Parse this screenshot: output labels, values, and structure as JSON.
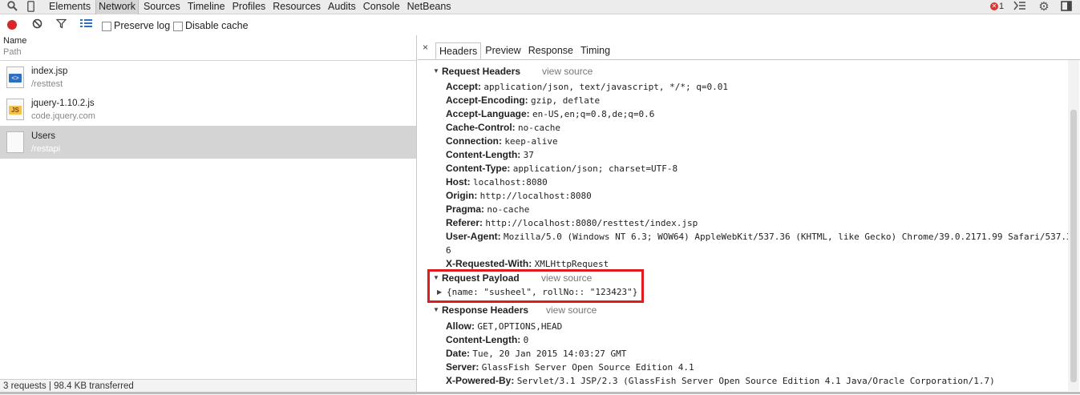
{
  "toolbar": {
    "tabs": [
      "Elements",
      "Network",
      "Sources",
      "Timeline",
      "Profiles",
      "Resources",
      "Audits",
      "Console",
      "NetBeans"
    ],
    "active_tab": "Network",
    "error_count": "1"
  },
  "filterbar": {
    "preserve_log": "Preserve log",
    "disable_cache": "Disable cache"
  },
  "requests": {
    "col_name": "Name",
    "col_path": "Path",
    "rows": [
      {
        "name": "index.jsp",
        "domain": "/resttest",
        "icon": "html-file-icon"
      },
      {
        "name": "jquery-1.10.2.js",
        "domain": "code.jquery.com",
        "icon": "js-file-icon"
      },
      {
        "name": "Users",
        "domain": "/restapi",
        "icon": "blank-file-icon"
      }
    ],
    "summary": "3 requests | 98.4 KB transferred"
  },
  "detail": {
    "close": "×",
    "tabs": [
      "Headers",
      "Preview",
      "Response",
      "Timing"
    ],
    "active_tab": "Headers",
    "view_source": "view source",
    "request_headers_title": "Request Headers",
    "request_headers": [
      {
        "k": "Accept:",
        "v": "application/json, text/javascript, */*; q=0.01"
      },
      {
        "k": "Accept-Encoding:",
        "v": "gzip, deflate"
      },
      {
        "k": "Accept-Language:",
        "v": "en-US,en;q=0.8,de;q=0.6"
      },
      {
        "k": "Cache-Control:",
        "v": "no-cache"
      },
      {
        "k": "Connection:",
        "v": "keep-alive"
      },
      {
        "k": "Content-Length:",
        "v": "37"
      },
      {
        "k": "Content-Type:",
        "v": "application/json; charset=UTF-8"
      },
      {
        "k": "Host:",
        "v": "localhost:8080"
      },
      {
        "k": "Origin:",
        "v": "http://localhost:8080"
      },
      {
        "k": "Pragma:",
        "v": "no-cache"
      },
      {
        "k": "Referer:",
        "v": "http://localhost:8080/resttest/index.jsp"
      },
      {
        "k": "User-Agent:",
        "v": "Mozilla/5.0 (Windows NT 6.3; WOW64) AppleWebKit/537.36 (KHTML, like Gecko) Chrome/39.0.2171.99 Safari/537.3"
      },
      {
        "k": "",
        "v": "6"
      },
      {
        "k": "X-Requested-With:",
        "v": "XMLHttpRequest"
      }
    ],
    "payload_title": "Request Payload",
    "payload": "{name: \"susheel\", rollNo:: \"123423\"}",
    "response_headers_title": "Response Headers",
    "response_headers": [
      {
        "k": "Allow:",
        "v": "GET,OPTIONS,HEAD"
      },
      {
        "k": "Content-Length:",
        "v": "0"
      },
      {
        "k": "Date:",
        "v": "Tue, 20 Jan 2015 14:03:27 GMT"
      },
      {
        "k": "Server:",
        "v": "GlassFish Server Open Source Edition  4.1"
      },
      {
        "k": "X-Powered-By:",
        "v": "Servlet/3.1 JSP/2.3 (GlassFish Server Open Source Edition  4.1  Java/Oracle Corporation/1.7)"
      }
    ]
  },
  "colors": {
    "highlight": "#e01b1b",
    "record": "#d62828",
    "selected_row": "#d4d4d4"
  }
}
